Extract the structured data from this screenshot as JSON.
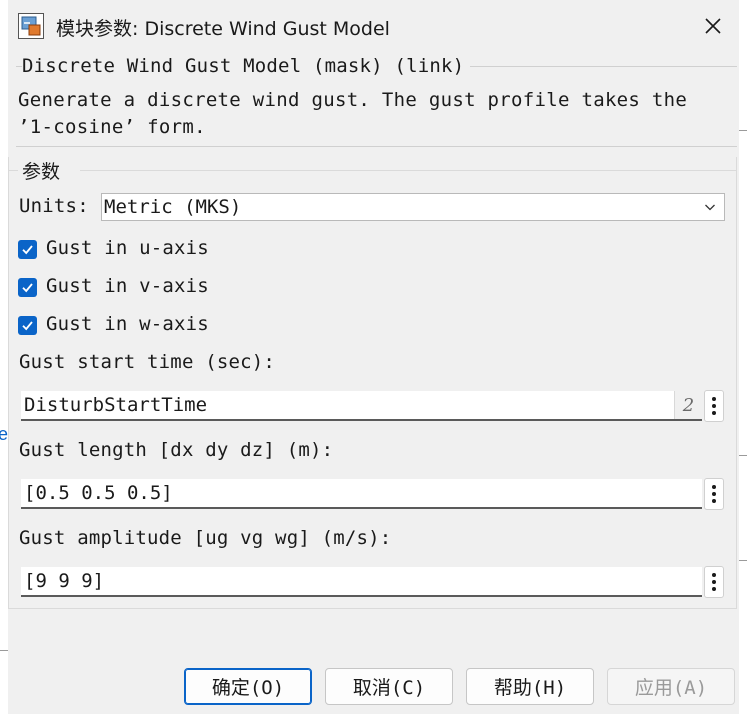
{
  "window": {
    "title": "模块参数: Discrete Wind Gust Model"
  },
  "block": {
    "header": "Discrete Wind Gust Model (mask) (link)",
    "description": "Generate a discrete wind gust. The gust profile takes the ’1-cosine’ form."
  },
  "parameters": {
    "legend": "参数",
    "units": {
      "label": "Units:",
      "value": "Metric (MKS)"
    },
    "checkboxes": [
      {
        "label": "Gust in u-axis",
        "checked": true
      },
      {
        "label": "Gust in v-axis",
        "checked": true
      },
      {
        "label": "Gust in w-axis",
        "checked": true
      }
    ],
    "start_time": {
      "label": "Gust start time (sec):",
      "value": "DisturbStartTime",
      "badge": "2"
    },
    "length": {
      "label": "Gust length [dx dy dz] (m):",
      "value": "[0.5 0.5 0.5]"
    },
    "amplitude": {
      "label": "Gust amplitude [ug vg wg] (m/s):",
      "value": "[9 9 9]"
    }
  },
  "buttons": {
    "ok": "确定(O)",
    "cancel": "取消(C)",
    "help": "帮助(H)",
    "apply": "应用(A)"
  },
  "colors": {
    "accent": "#0a64c8",
    "dialog_bg": "#f0f0f0"
  }
}
